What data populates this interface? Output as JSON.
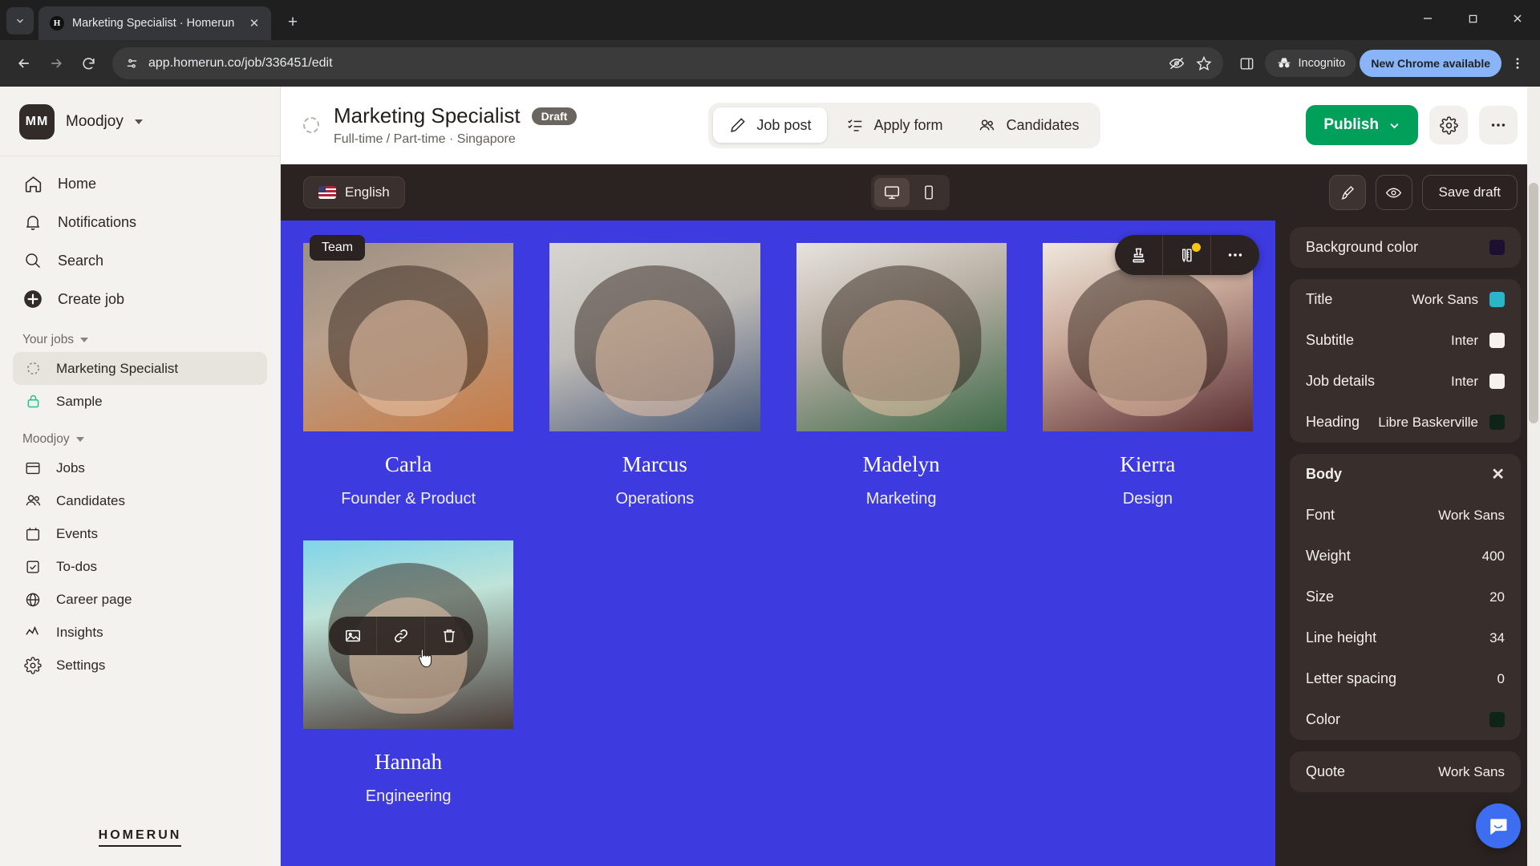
{
  "browser": {
    "tab": {
      "title": "Marketing Specialist · Homerun",
      "favicon_letter": "H",
      "close_icon": "close-icon"
    },
    "new_tab_label": "+",
    "url": "app.homerun.co/job/336451/edit",
    "incognito_label": "Incognito",
    "update_label": "New Chrome available",
    "icons": {
      "tab_search": "chevron-down-icon",
      "back": "back-arrow-icon",
      "forward": "forward-arrow-icon",
      "reload": "reload-icon",
      "site_info": "site-settings-icon",
      "tracking": "eye-off-icon",
      "bookmark": "star-icon",
      "side_panel": "side-panel-icon",
      "menu": "kebab-menu-icon",
      "minimize": "minimize-icon",
      "maximize": "maximize-icon",
      "win_close": "window-close-icon"
    }
  },
  "sidebar": {
    "org": {
      "initials": "MM",
      "name": "Moodjoy"
    },
    "nav": [
      {
        "label": "Home",
        "icon": "home-icon"
      },
      {
        "label": "Notifications",
        "icon": "bell-icon"
      },
      {
        "label": "Search",
        "icon": "search-icon"
      },
      {
        "label": "Create job",
        "icon": "plus-circle-icon"
      }
    ],
    "your_jobs_label": "Your jobs",
    "jobs": [
      {
        "label": "Marketing Specialist",
        "icon": "draft-spinner-icon",
        "active": true
      },
      {
        "label": "Sample",
        "icon": "lock-icon",
        "active": false
      }
    ],
    "workspace_label": "Moodjoy",
    "workspace_items": [
      {
        "label": "Jobs",
        "icon": "board-icon"
      },
      {
        "label": "Candidates",
        "icon": "people-icon"
      },
      {
        "label": "Events",
        "icon": "calendar-icon"
      },
      {
        "label": "To-dos",
        "icon": "checkbox-icon"
      },
      {
        "label": "Career page",
        "icon": "globe-icon"
      },
      {
        "label": "Insights",
        "icon": "chart-line-icon"
      },
      {
        "label": "Settings",
        "icon": "gear-icon"
      }
    ],
    "logo": "HOMERUN"
  },
  "header": {
    "job_title": "Marketing Specialist",
    "status_badge": "Draft",
    "job_subtitle": "Full-time / Part-time · Singapore",
    "tabs": [
      {
        "label": "Job post",
        "icon": "pencil-icon",
        "active": true
      },
      {
        "label": "Apply form",
        "icon": "checklist-icon",
        "active": false
      },
      {
        "label": "Candidates",
        "icon": "people-icon",
        "active": false
      }
    ],
    "publish_label": "Publish",
    "publish_color": "#00a05a",
    "settings_icon": "gear-icon",
    "more_icon": "ellipsis-icon"
  },
  "editor_bar": {
    "language": "English",
    "language_flag": "us-flag-icon",
    "devices": [
      {
        "name": "desktop-view",
        "icon": "monitor-icon",
        "active": true
      },
      {
        "name": "mobile-view",
        "icon": "phone-icon",
        "active": false
      }
    ],
    "brush_icon": "paintbrush-icon",
    "preview_icon": "eye-icon",
    "save_label": "Save draft"
  },
  "canvas": {
    "background_color": "#3d3ae0",
    "section_tag": "Team",
    "block_toolbar": [
      {
        "name": "block-type-icon",
        "icon": "stamp-icon",
        "badge": false
      },
      {
        "name": "block-style-icon",
        "icon": "ruler-pencil-icon",
        "badge": true
      },
      {
        "name": "block-more-icon",
        "icon": "ellipsis-icon",
        "badge": false
      }
    ],
    "image_toolbar": [
      {
        "name": "replace-image-icon",
        "icon": "image-icon"
      },
      {
        "name": "add-link-icon",
        "icon": "link-icon"
      },
      {
        "name": "delete-image-icon",
        "icon": "trash-icon"
      }
    ],
    "members": [
      {
        "name": "Carla",
        "role": "Founder & Product"
      },
      {
        "name": "Marcus",
        "role": "Operations"
      },
      {
        "name": "Madelyn",
        "role": "Marketing"
      },
      {
        "name": "Kierra",
        "role": "Design"
      },
      {
        "name": "Hannah",
        "role": "Engineering"
      }
    ]
  },
  "right_panel": {
    "background_row": {
      "label": "Background color",
      "swatch": "#1c1030"
    },
    "typography": [
      {
        "label": "Title",
        "value": "Work Sans",
        "swatch": "#2ab5c8"
      },
      {
        "label": "Subtitle",
        "value": "Inter",
        "swatch": "#f7f1ee"
      },
      {
        "label": "Job details",
        "value": "Inter",
        "swatch": "#f7f1ee"
      },
      {
        "label": "Heading",
        "value": "Libre Baskerville",
        "swatch": "#0f2419"
      }
    ],
    "body": {
      "title": "Body",
      "close_icon": "close-icon",
      "rows": [
        {
          "label": "Font",
          "value": "Work Sans"
        },
        {
          "label": "Weight",
          "value": "400"
        },
        {
          "label": "Size",
          "value": "20"
        },
        {
          "label": "Line height",
          "value": "34"
        },
        {
          "label": "Letter spacing",
          "value": "0"
        },
        {
          "label": "Color",
          "value": "",
          "swatch": "#0f2419"
        }
      ]
    },
    "quote": {
      "label": "Quote",
      "value": "Work Sans"
    }
  },
  "chat_widget": {
    "icon": "chat-bubble-icon",
    "color": "#3d6df0"
  }
}
